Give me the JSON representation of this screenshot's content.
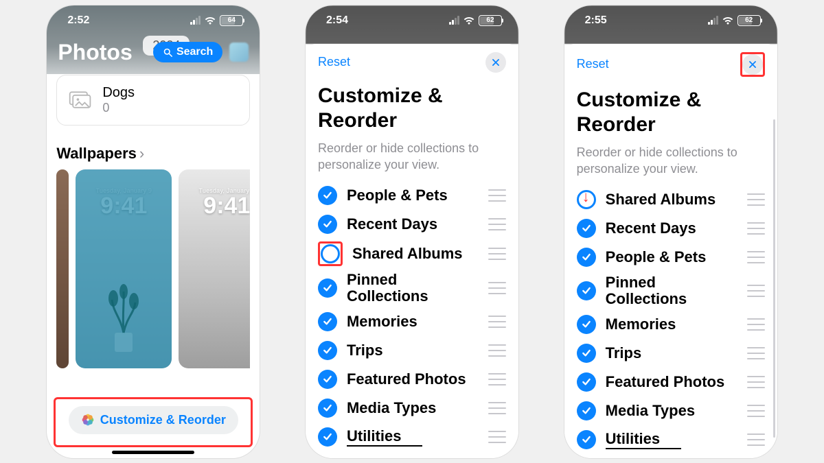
{
  "screen1": {
    "time": "2:52",
    "battery": "64",
    "title": "Photos",
    "year": "2024",
    "search": "Search",
    "album": {
      "name": "Dogs",
      "count": "0"
    },
    "section": "Wallpapers",
    "wallpaper_time": {
      "date": "Tuesday, January 9",
      "clock": "9:41"
    },
    "customize_btn": "Customize & Reorder"
  },
  "sheet": {
    "reset": "Reset",
    "title": "Customize & Reorder",
    "subtitle": "Reorder or hide collections to personalize your view."
  },
  "screen2": {
    "time": "2:54",
    "battery": "62",
    "items": [
      {
        "label": "People & Pets",
        "checked": true
      },
      {
        "label": "Recent Days",
        "checked": true
      },
      {
        "label": "Shared Albums",
        "checked": false,
        "highlight": true
      },
      {
        "label": "Pinned Collections",
        "checked": true
      },
      {
        "label": "Memories",
        "checked": true
      },
      {
        "label": "Trips",
        "checked": true
      },
      {
        "label": "Featured Photos",
        "checked": true
      },
      {
        "label": "Media Types",
        "checked": true
      },
      {
        "label": "Utilities",
        "checked": true,
        "trailing_underline": true
      }
    ]
  },
  "screen3": {
    "time": "2:55",
    "battery": "62",
    "close_highlight": true,
    "arrow_to_first": true,
    "items": [
      {
        "label": "Shared Albums",
        "checked": false
      },
      {
        "label": "Recent Days",
        "checked": true
      },
      {
        "label": "People & Pets",
        "checked": true
      },
      {
        "label": "Pinned Collections",
        "checked": true
      },
      {
        "label": "Memories",
        "checked": true
      },
      {
        "label": "Trips",
        "checked": true
      },
      {
        "label": "Featured Photos",
        "checked": true
      },
      {
        "label": "Media Types",
        "checked": true
      },
      {
        "label": "Utilities",
        "checked": true,
        "trailing_underline": true
      }
    ]
  }
}
